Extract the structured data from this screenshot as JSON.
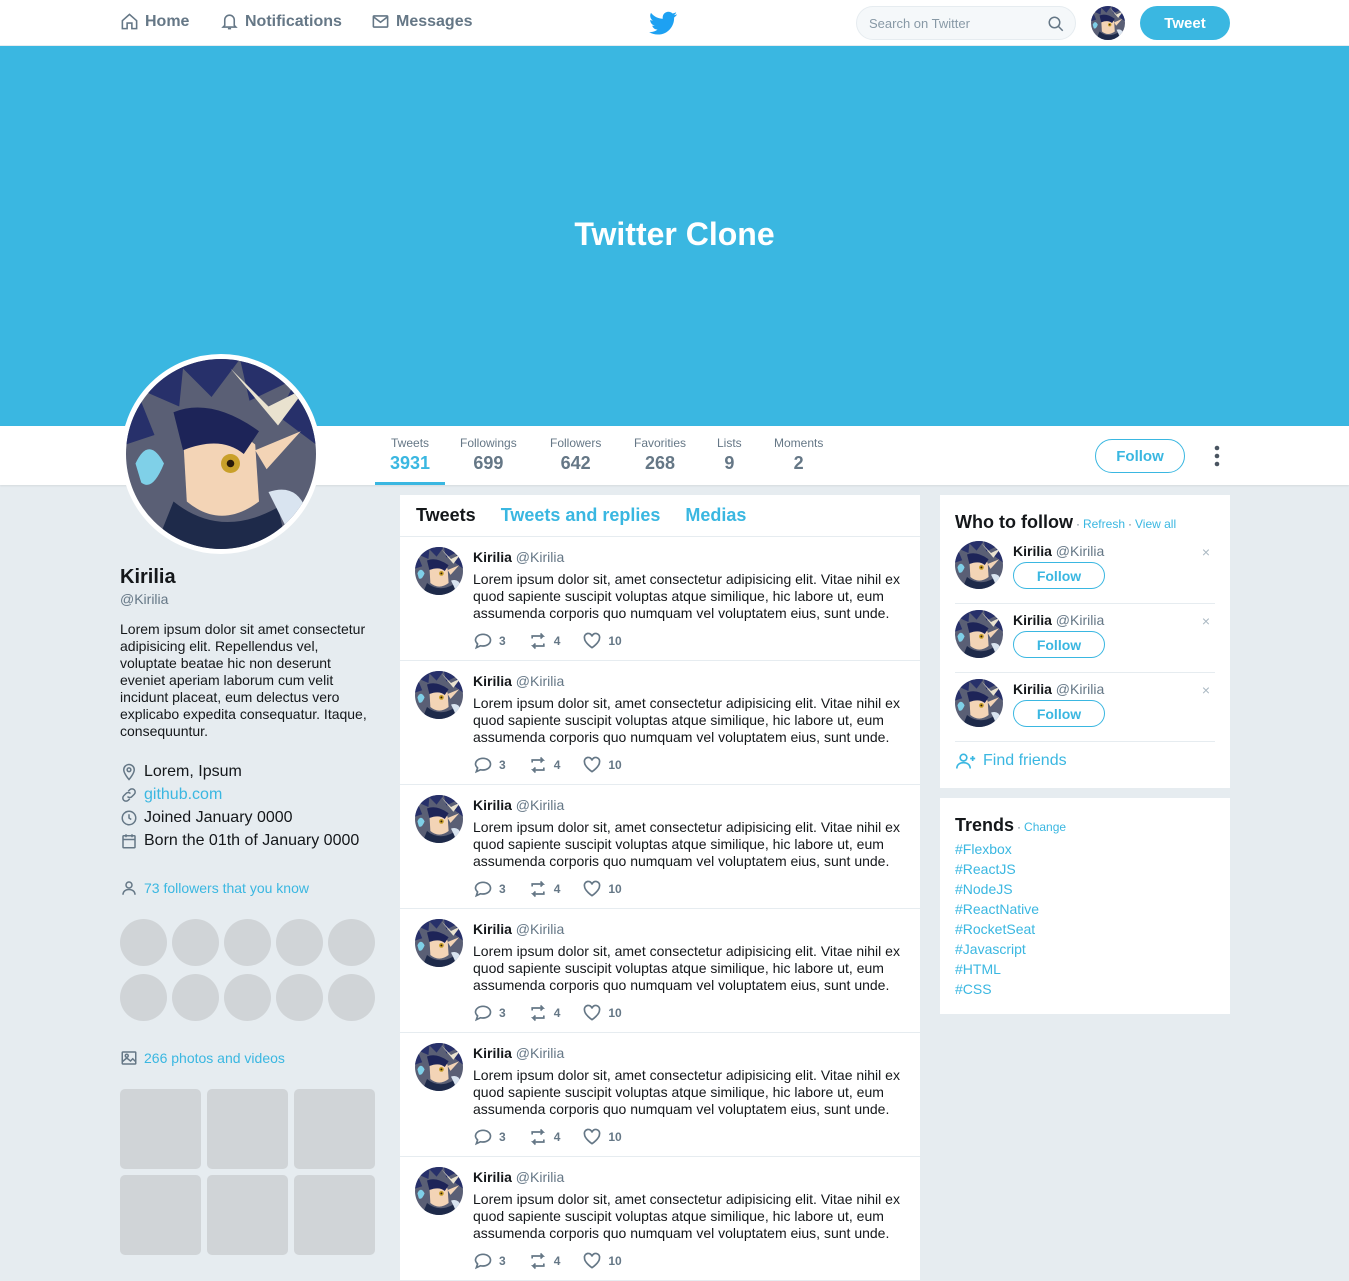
{
  "nav": {
    "home": "Home",
    "notifications": "Notifications",
    "messages": "Messages",
    "search_placeholder": "Search on Twitter",
    "tweet_button": "Tweet"
  },
  "banner": {
    "title": "Twitter Clone"
  },
  "stats": [
    {
      "label": "Tweets",
      "value": "3931"
    },
    {
      "label": "Followings",
      "value": "699"
    },
    {
      "label": "Followers",
      "value": "642"
    },
    {
      "label": "Favorities",
      "value": "268"
    },
    {
      "label": "Lists",
      "value": "9"
    },
    {
      "label": "Moments",
      "value": "2"
    }
  ],
  "profile": {
    "follow_button": "Follow",
    "name": "Kirilia",
    "handle": "@Kirilia",
    "bio": "Lorem ipsum dolor sit amet consectetur adipisicing elit. Repellendus vel, voluptate beatae hic non deserunt eveniet aperiam laborum cum velit incidunt placeat, eum delectus vero explicabo expedita consequatur. Itaque, consequuntur.",
    "location": "Lorem, Ipsum",
    "website": "github.com",
    "joined": "Joined January 0000",
    "born": "Born the 01th of January 0000",
    "followers_you_know": "73 followers that you know",
    "photos_videos": "266 photos and videos"
  },
  "feed": {
    "tabs": [
      "Tweets",
      "Tweets and replies",
      "Medias"
    ],
    "tweets": [
      {
        "name": "Kirilia",
        "handle": "@Kirilia",
        "text": "Lorem ipsum dolor sit, amet consectetur adipisicing elit. Vitae nihil ex quod sapiente suscipit voluptas atque similique, hic labore ut, eum assumenda corporis quo numquam vel voluptatem eius, sunt unde.",
        "replies": "3",
        "retweets": "4",
        "likes": "10"
      },
      {
        "name": "Kirilia",
        "handle": "@Kirilia",
        "text": "Lorem ipsum dolor sit, amet consectetur adipisicing elit. Vitae nihil ex quod sapiente suscipit voluptas atque similique, hic labore ut, eum assumenda corporis quo numquam vel voluptatem eius, sunt unde.",
        "replies": "3",
        "retweets": "4",
        "likes": "10"
      },
      {
        "name": "Kirilia",
        "handle": "@Kirilia",
        "text": "Lorem ipsum dolor sit, amet consectetur adipisicing elit. Vitae nihil ex quod sapiente suscipit voluptas atque similique, hic labore ut, eum assumenda corporis quo numquam vel voluptatem eius, sunt unde.",
        "replies": "3",
        "retweets": "4",
        "likes": "10"
      },
      {
        "name": "Kirilia",
        "handle": "@Kirilia",
        "text": "Lorem ipsum dolor sit, amet consectetur adipisicing elit. Vitae nihil ex quod sapiente suscipit voluptas atque similique, hic labore ut, eum assumenda corporis quo numquam vel voluptatem eius, sunt unde.",
        "replies": "3",
        "retweets": "4",
        "likes": "10"
      },
      {
        "name": "Kirilia",
        "handle": "@Kirilia",
        "text": "Lorem ipsum dolor sit, amet consectetur adipisicing elit. Vitae nihil ex quod sapiente suscipit voluptas atque similique, hic labore ut, eum assumenda corporis quo numquam vel voluptatem eius, sunt unde.",
        "replies": "3",
        "retweets": "4",
        "likes": "10"
      },
      {
        "name": "Kirilia",
        "handle": "@Kirilia",
        "text": "Lorem ipsum dolor sit, amet consectetur adipisicing elit. Vitae nihil ex quod sapiente suscipit voluptas atque similique, hic labore ut, eum assumenda corporis quo numquam vel voluptatem eius, sunt unde.",
        "replies": "3",
        "retweets": "4",
        "likes": "10"
      }
    ]
  },
  "who_to_follow": {
    "title": "Who to follow",
    "refresh": "Refresh",
    "view_all": "View all",
    "separator": "·",
    "close": "×",
    "items": [
      {
        "name": "Kirilia",
        "handle": "@Kirilia",
        "button": "Follow"
      },
      {
        "name": "Kirilia",
        "handle": "@Kirilia",
        "button": "Follow"
      },
      {
        "name": "Kirilia",
        "handle": "@Kirilia",
        "button": "Follow"
      }
    ],
    "find_friends": "Find friends"
  },
  "trends": {
    "title": "Trends",
    "change": "Change",
    "items": [
      "#Flexbox",
      "#ReactJS",
      "#NodeJS",
      "#ReactNative",
      "#RocketSeat",
      "#Javascript",
      "#HTML",
      "#CSS"
    ]
  },
  "colors": {
    "accent": "#3ab7e1",
    "background": "#e6ecf0",
    "placeholder": "#d0d4d7"
  }
}
